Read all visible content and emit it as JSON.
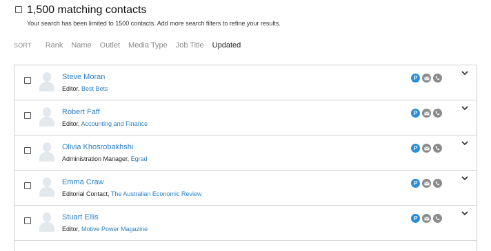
{
  "header": {
    "title": "1,500 matching contacts",
    "subtitle": "Your search has been limited to 1500 contacts. Add more search filters to refine your results."
  },
  "sort": {
    "label": "SORT",
    "options": [
      "Rank",
      "Name",
      "Outlet",
      "Media Type",
      "Job Title",
      "Updated"
    ],
    "active": "Updated"
  },
  "contacts": [
    {
      "name": "Steve Moran",
      "role": "Editor",
      "outlet": "Best Bets"
    },
    {
      "name": "Robert Faff",
      "role": "Editor",
      "outlet": "Accounting and Finance"
    },
    {
      "name": "Olivia Khosrobakhshi",
      "role": "Administration Manager",
      "outlet": "Egrad"
    },
    {
      "name": "Emma Craw",
      "role": "Editorial Contact",
      "outlet": "The Australian Economic Review"
    },
    {
      "name": "Stuart Ellis",
      "role": "Editor",
      "outlet": "Motive Power Magazine"
    }
  ],
  "icons": [
    "preferred-icon",
    "email-icon",
    "phone-icon",
    "chevron-down-icon"
  ],
  "colors": {
    "link": "#2a7fc4",
    "preferred": "#2b8fd8",
    "icon_gray": "#8b8b8b",
    "border": "#cfcfcf"
  }
}
